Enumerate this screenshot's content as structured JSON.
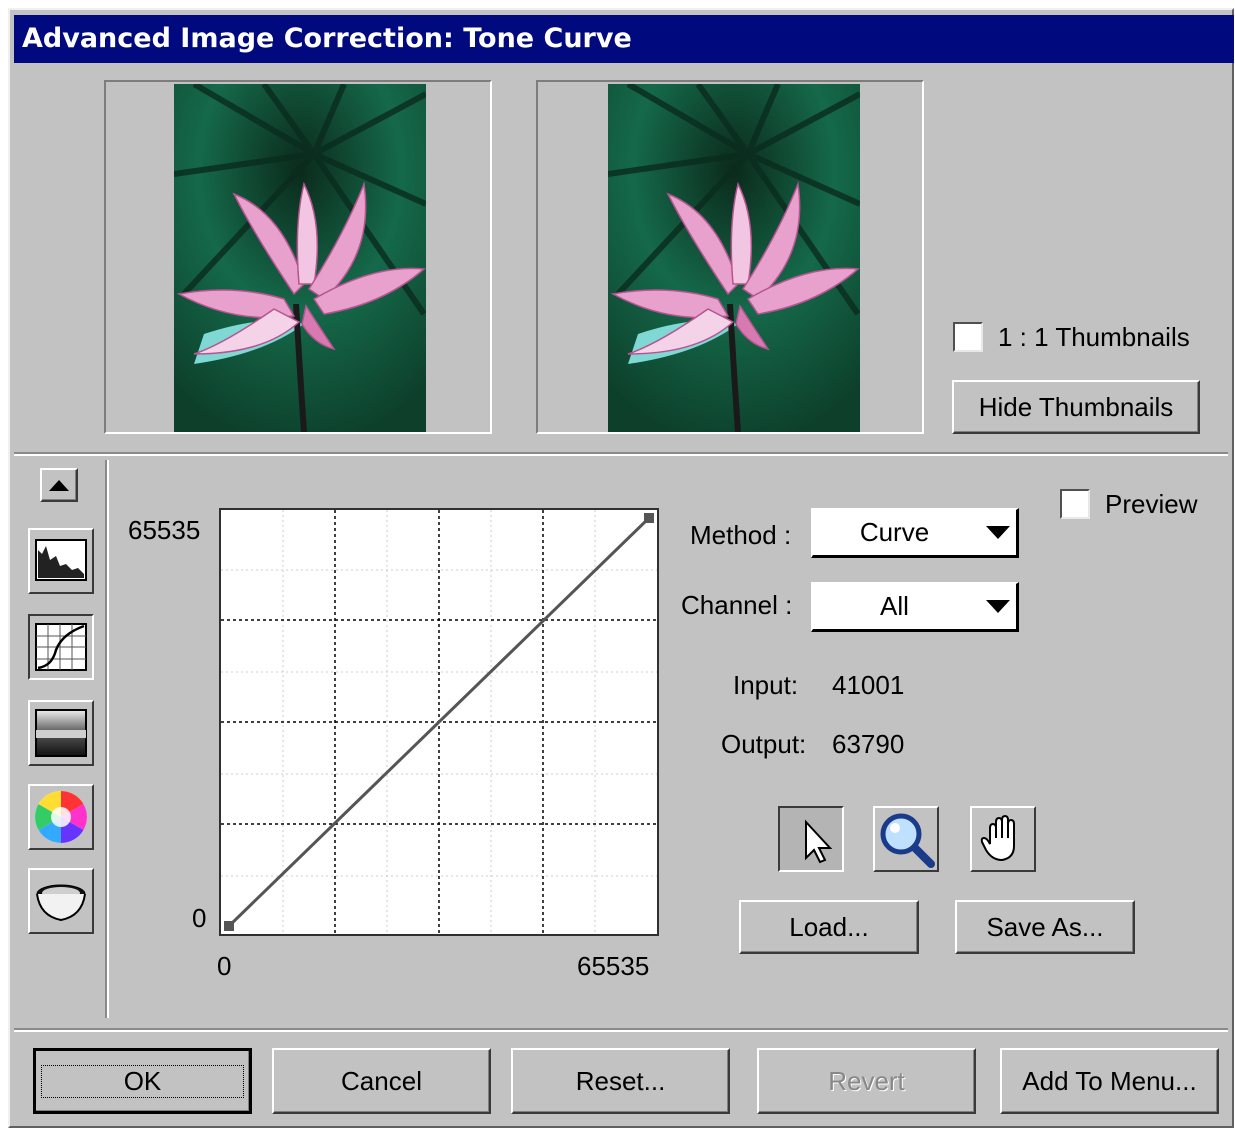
{
  "window": {
    "title": "Advanced Image Correction: Tone Curve"
  },
  "thumbnails": {
    "one_to_one_label": "1 : 1 Thumbnails",
    "one_to_one_checked": false,
    "hide_label": "Hide Thumbnails"
  },
  "palette": {
    "items": [
      "histogram-icon",
      "tone-curve-icon",
      "gradient-icon",
      "color-wheel-icon",
      "bowl-icon"
    ],
    "selected": "tone-curve-icon"
  },
  "curve": {
    "y_max_label": "65535",
    "y_min_label": "0",
    "x_min_label": "0",
    "x_max_label": "65535",
    "start_point": [
      0,
      0
    ],
    "end_point": [
      65535,
      65535
    ]
  },
  "controls": {
    "method_label": "Method :",
    "method_value": "Curve",
    "channel_label": "Channel :",
    "channel_value": "All",
    "preview_label": "Preview",
    "preview_checked": false,
    "input_label": "Input:",
    "input_value": "41001",
    "output_label": "Output:",
    "output_value": "63790",
    "tools": [
      "arrow-pointer-icon",
      "magnifier-icon",
      "hand-icon"
    ],
    "active_tool": "arrow-pointer-icon",
    "load_label": "Load...",
    "save_as_label": "Save As..."
  },
  "footer": {
    "ok_label": "OK",
    "cancel_label": "Cancel",
    "reset_label": "Reset...",
    "revert_label": "Revert",
    "add_to_menu_label": "Add To Menu..."
  },
  "colors": {
    "titlebar": "#000a7e",
    "face": "#c2c2c2"
  }
}
